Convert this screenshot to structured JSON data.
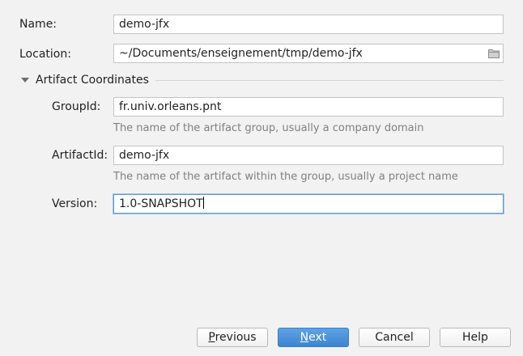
{
  "form": {
    "name": {
      "label": "Name:",
      "value": "demo-jfx"
    },
    "location": {
      "label": "Location:",
      "value": "~/Documents/enseignement/tmp/demo-jfx",
      "icon": "folder-icon"
    }
  },
  "artifact": {
    "section_title": "Artifact Coordinates",
    "group_id": {
      "label": "GroupId:",
      "value": "fr.univ.orleans.pnt",
      "hint": "The name of the artifact group, usually a company domain"
    },
    "artifact_id": {
      "label": "ArtifactId:",
      "value": "demo-jfx",
      "hint": "The name of the artifact within the group, usually a project name"
    },
    "version": {
      "label": "Version:",
      "value": "1.0-SNAPSHOT"
    }
  },
  "buttons": {
    "previous": {
      "mnemonic": "P",
      "rest": "revious"
    },
    "next": {
      "mnemonic": "N",
      "rest": "ext"
    },
    "cancel": "Cancel",
    "help": "Help"
  },
  "colors": {
    "background": "#f2f2f2",
    "primary_button": "#4a90d9",
    "focus_border": "#5b9bd5",
    "hint_text": "#808080"
  }
}
